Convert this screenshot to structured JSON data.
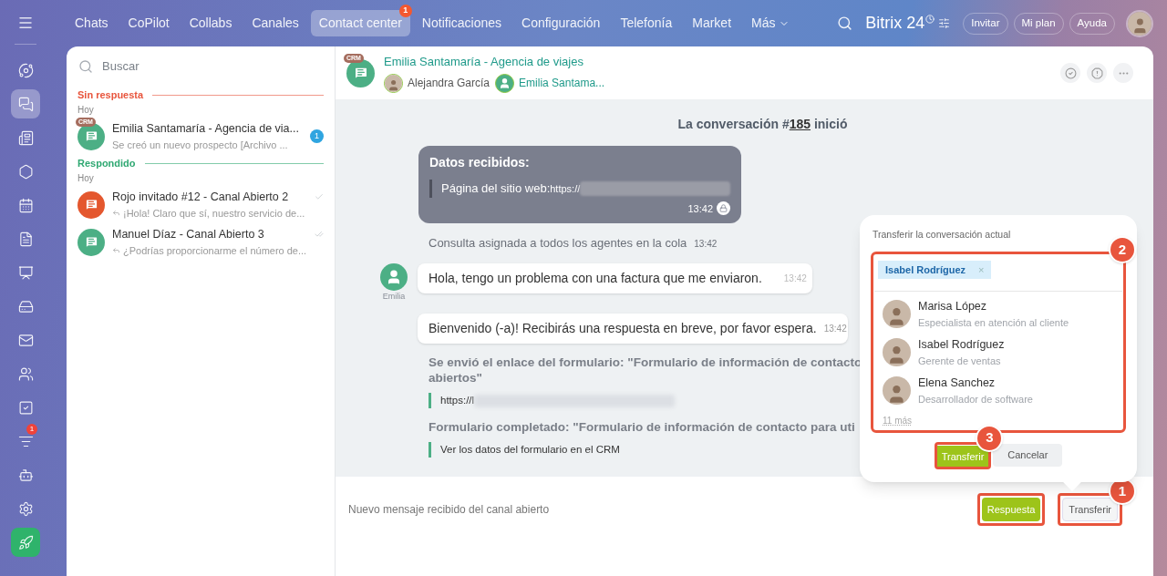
{
  "top_nav": {
    "items": [
      {
        "label": "Chats",
        "selected": false
      },
      {
        "label": "CoPilot",
        "selected": false
      },
      {
        "label": "Collabs",
        "selected": false
      },
      {
        "label": "Canales",
        "selected": false
      },
      {
        "label": "Contact center",
        "selected": true,
        "badge": "1"
      },
      {
        "label": "Notificaciones",
        "selected": false
      },
      {
        "label": "Configuración",
        "selected": false
      },
      {
        "label": "Telefonía",
        "selected": false
      },
      {
        "label": "Market",
        "selected": false
      }
    ],
    "more": "Más",
    "logo": {
      "name": "Bitrix",
      "number": "24"
    },
    "buttons": [
      "Invitar",
      "Mi plan",
      "Ayuda"
    ]
  },
  "sidebar": {
    "items": [
      {
        "kind": "orbit",
        "selected": false
      },
      {
        "kind": "chats",
        "selected": true
      },
      {
        "kind": "feed",
        "selected": false
      },
      {
        "kind": "hexagon",
        "selected": false
      },
      {
        "kind": "calendar",
        "selected": false
      },
      {
        "kind": "document",
        "selected": false
      },
      {
        "kind": "presentation",
        "selected": false
      },
      {
        "kind": "drive",
        "selected": false
      },
      {
        "kind": "mail",
        "selected": false
      },
      {
        "kind": "contacts",
        "selected": false
      },
      {
        "kind": "tasks",
        "selected": false
      },
      {
        "kind": "funnel",
        "selected": false,
        "badge": "1"
      },
      {
        "kind": "bot",
        "selected": false
      },
      {
        "kind": "settings",
        "selected": false
      },
      {
        "kind": "rocket",
        "selected": false
      }
    ]
  },
  "chat_list": {
    "search": {
      "placeholder": "Buscar"
    },
    "groups": [
      {
        "title": "Sin respuesta",
        "color": "#e8553d",
        "date": "Hoy",
        "chats": [
          {
            "title": "Emilia Santamaría - Agencia de via...",
            "preview": "Se creó un nuevo prospecto [Archivo ...",
            "color": "#4caf85",
            "crm": "CRM",
            "unread": "1",
            "reply": false
          }
        ]
      },
      {
        "title": "Respondido",
        "color": "#2fa872",
        "date": "Hoy",
        "chats": [
          {
            "title": "Rojo invitado #12 - Canal Abierto 2",
            "preview": "¡Hola! Claro que sí, nuestro servicio de...",
            "color": "#e4572e",
            "read": false,
            "reply": true
          },
          {
            "title": "Manuel Díaz - Canal Abierto 3",
            "preview": "¿Podrías proporcionarme el número de...",
            "color": "#4caf85",
            "read": true,
            "reply": true
          }
        ]
      }
    ]
  },
  "chat": {
    "header": {
      "title": "Emilia Santamaría - Agencia de viajes",
      "crm": "CRM",
      "members": [
        {
          "name": "Alejandra García",
          "kind": "photo"
        },
        {
          "name": "Emilia Santama...",
          "kind": "client"
        }
      ]
    },
    "messages": [
      {
        "kind": "system",
        "text": "La conversación #**185** inició"
      },
      {
        "kind": "data",
        "title": "Datos recibidos:",
        "label": "Página del sitio web:",
        "link": "https://",
        "time": "13:42"
      },
      {
        "kind": "note",
        "text": "Consulta asignada a todos los agentes en la cola",
        "time": "13:42"
      },
      {
        "kind": "incoming",
        "author": "Emilia",
        "text": "Hola, tengo un problema con una factura que me enviaron.",
        "time": "13:42"
      },
      {
        "kind": "outgoing",
        "text": "Bienvenido (-a)! Recibirás una respuesta en breve, por favor espera.",
        "time": "13:42"
      },
      {
        "kind": "form",
        "lines": [
          "Se envió el enlace del formulario: \"Formulario de información de contacto",
          "abiertos\""
        ],
        "link": "https://l",
        "blurred": true
      },
      {
        "kind": "form",
        "lines": [
          "Formulario completado: \"Formulario de información de contacto para uti"
        ],
        "link": "Ver los datos del formulario en el CRM",
        "blurred": false
      }
    ],
    "footer": {
      "text": "Nuevo mensaje recibido del canal abierto",
      "reply_button": "Respuesta",
      "transfer_button": "Transferir",
      "callout": "1"
    }
  },
  "transfer_popup": {
    "title": "Transferir la conversación actual",
    "token": "Isabel Rodríguez",
    "remove": "×",
    "people": [
      {
        "name": "Marisa López",
        "role": "Especialista en atención al cliente"
      },
      {
        "name": "Isabel Rodríguez",
        "role": "Gerente de ventas"
      },
      {
        "name": "Elena Sanchez",
        "role": "Desarrollador de software"
      }
    ],
    "more": "11 más",
    "confirm": "Transferir",
    "cancel": "Cancelar",
    "list_callout": "2",
    "confirm_callout": "3"
  }
}
